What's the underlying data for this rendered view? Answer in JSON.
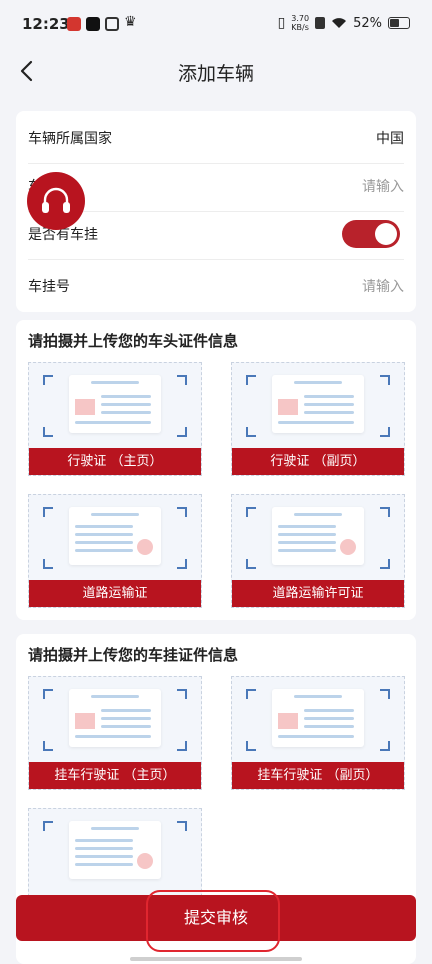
{
  "status_bar": {
    "time": "12:23",
    "net_speed": "3.70",
    "net_unit": "KB/s",
    "battery": "52%"
  },
  "header": {
    "title": "添加车辆"
  },
  "form": {
    "country": {
      "label": "车辆所属国家",
      "value": "中国"
    },
    "plate": {
      "label": "车",
      "placeholder": "请输入"
    },
    "trailer_toggle": {
      "label": "是否有车挂",
      "on": true
    },
    "trailer_number": {
      "label": "车挂号",
      "placeholder": "请输入"
    }
  },
  "head_docs": {
    "title": "请拍摄并上传您的车头证件信息",
    "items": [
      "行驶证 （主页）",
      "行驶证 （副页）",
      "道路运输证",
      "道路运输许可证"
    ]
  },
  "trailer_docs": {
    "title": "请拍摄并上传您的车挂证件信息",
    "items": [
      "挂车行驶证 （主页）",
      "挂车行驶证 （副页）"
    ]
  },
  "submit": {
    "label": "提交审核"
  },
  "colors": {
    "primary": "#b8141f",
    "background": "#f3f4f8",
    "toggle": "#b8222b"
  }
}
